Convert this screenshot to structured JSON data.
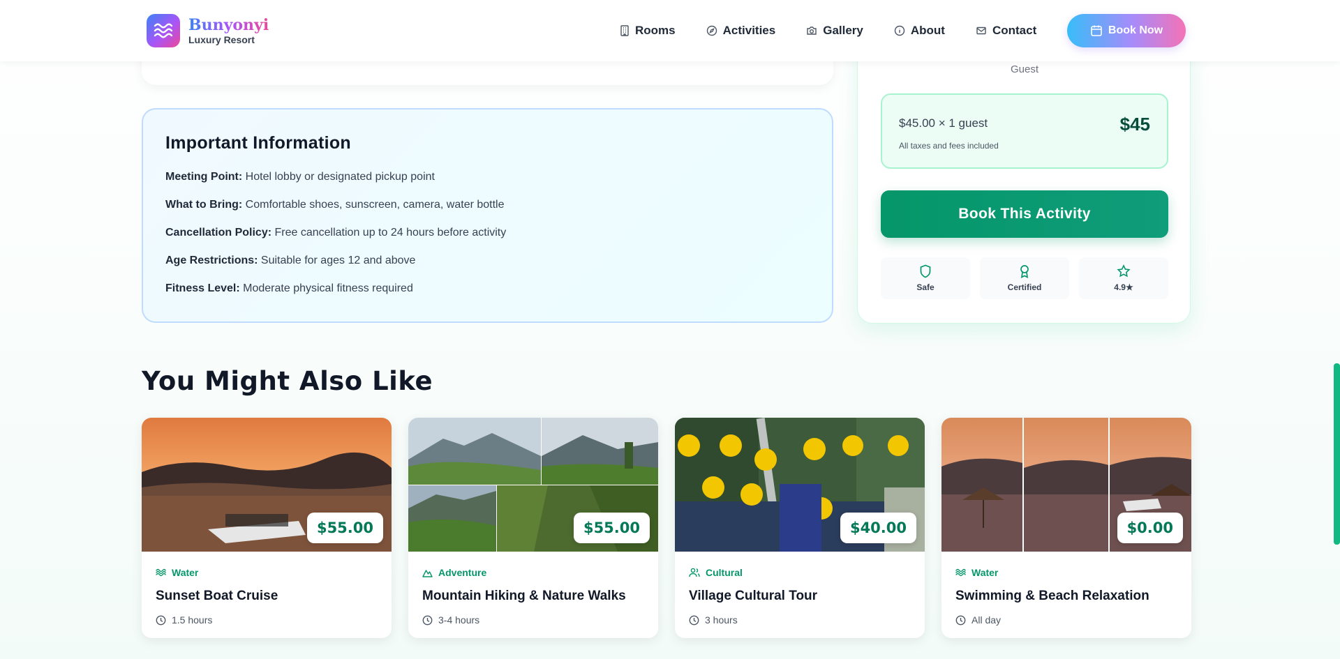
{
  "brand": {
    "name": "Bunyonyi",
    "tagline": "Luxury Resort",
    "gradient": [
      "#3b82f6",
      "#a855f7",
      "#ec4899"
    ]
  },
  "nav": {
    "items": [
      {
        "label": "Rooms",
        "icon": "building-icon"
      },
      {
        "label": "Activities",
        "icon": "compass-icon"
      },
      {
        "label": "Gallery",
        "icon": "camera-icon"
      },
      {
        "label": "About",
        "icon": "info-icon"
      },
      {
        "label": "Contact",
        "icon": "mail-icon"
      }
    ],
    "cta": "Book Now"
  },
  "important_info": {
    "title": "Important Information",
    "rows": [
      {
        "label": "Meeting Point:",
        "value": "Hotel lobby or designated pickup point"
      },
      {
        "label": "What to Bring:",
        "value": "Comfortable shoes, sunscreen, camera, water bottle"
      },
      {
        "label": "Cancellation Policy:",
        "value": "Free cancellation up to 24 hours before activity"
      },
      {
        "label": "Age Restrictions:",
        "value": "Suitable for ages 12 and above"
      },
      {
        "label": "Fitness Level:",
        "value": "Moderate physical fitness required"
      }
    ]
  },
  "booking": {
    "guest_label": "Guest",
    "price_line": "$45.00 × 1 guest",
    "total": "$45",
    "note": "All taxes and fees included",
    "cta": "Book This Activity",
    "badges": [
      {
        "label": "Safe",
        "icon": "shield-icon"
      },
      {
        "label": "Certified",
        "icon": "award-icon"
      },
      {
        "label": "4.9★",
        "icon": "star-icon"
      }
    ],
    "accent": "#059669"
  },
  "related": {
    "title": "You Might Also Like",
    "cards": [
      {
        "price": "$55.00",
        "category": "Water",
        "title": "Sunset Boat Cruise",
        "duration": "1.5 hours",
        "cat_icon": "waves-icon"
      },
      {
        "price": "$55.00",
        "category": "Adventure",
        "title": "Mountain Hiking & Nature Walks",
        "duration": "3-4 hours",
        "cat_icon": "mountain-icon"
      },
      {
        "price": "$40.00",
        "category": "Cultural",
        "title": "Village Cultural Tour",
        "duration": "3 hours",
        "cat_icon": "users-icon"
      },
      {
        "price": "$0.00",
        "category": "Water",
        "title": "Swimming & Beach Relaxation",
        "duration": "All day",
        "cat_icon": "waves-icon"
      }
    ]
  }
}
